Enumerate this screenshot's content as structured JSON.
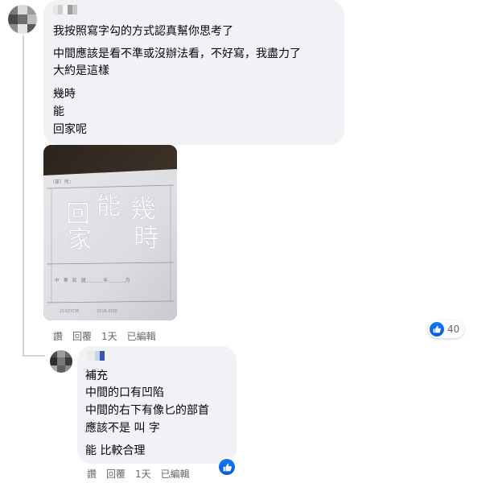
{
  "comment1": {
    "lines": [
      "我按照寫字勾的方式認真幫你思考了",
      "中間應該是看不準或沒辦法看，不好寫，我盡力了",
      "大約是這樣",
      "幾時",
      "能",
      "回家呢"
    ],
    "actions": {
      "like": "讚",
      "reply": "回覆",
      "time": "1天",
      "edited": "已編輯"
    },
    "reaction_count": "40",
    "photo": {
      "form_label": "（單）所：",
      "handwritten": [
        "回",
        "家",
        "能",
        "幾",
        "時"
      ],
      "date_line": "中　華　民　國＿＿＿＿年＿＿＿＿月",
      "footer_left": "21X27CM",
      "footer_right": "2016.02印"
    }
  },
  "comment2": {
    "lines": [
      "補充",
      "中間的口有凹陷",
      "中間的右下有像匕的部首",
      "應該不是 叫 字",
      "能 比較合理"
    ],
    "actions": {
      "like": "讚",
      "reply": "回覆",
      "time": "1天",
      "edited": "已編輯"
    }
  },
  "colors": {
    "bubble": "#f0f2f5",
    "meta_text": "#65676b",
    "like_blue": "#1877f2"
  },
  "icons": [
    "like-icon"
  ]
}
